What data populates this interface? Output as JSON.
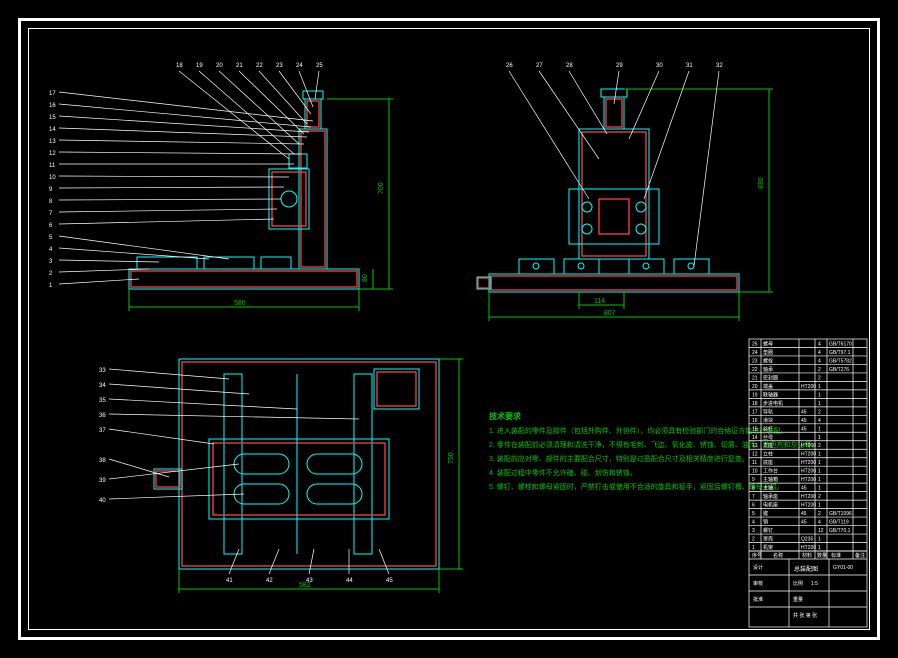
{
  "drawing": {
    "border_color": "#ffffff",
    "background": "#000000",
    "accent_cyan": "#00ffff",
    "accent_green": "#00c800",
    "accent_red": "#ff4040"
  },
  "views": {
    "front": {
      "dims": {
        "width": "580",
        "height": "700",
        "base_h": "80"
      }
    },
    "side": {
      "dims": {
        "width": "807",
        "height": "830",
        "slot": "114"
      }
    },
    "top": {
      "dims": {
        "width": "582",
        "height": "750"
      }
    }
  },
  "callouts": {
    "front_left": [
      "1",
      "2",
      "3",
      "4",
      "5",
      "6",
      "7",
      "8",
      "9",
      "10",
      "11",
      "12",
      "13",
      "14",
      "15",
      "16",
      "17"
    ],
    "front_top": [
      "18",
      "19",
      "20",
      "21",
      "22",
      "23",
      "24",
      "25"
    ],
    "side_top": [
      "26",
      "27",
      "28",
      "29",
      "30",
      "31",
      "32"
    ],
    "top_left": [
      "33",
      "34",
      "35",
      "36",
      "37",
      "38",
      "39",
      "40"
    ],
    "top_bottom": [
      "41",
      "42",
      "43",
      "44",
      "45"
    ]
  },
  "notes": {
    "title": "技术要求",
    "lines": [
      "1. 进入装配的零件及部件（包括外购件、外协件），均必须具有检验部门的合格证方能进行装配。",
      "2. 零件在装配前必须清理和清洗干净，不得有毛刺、飞边、氧化皮、锈蚀、切屑、油污、着色剂和灰尘等。",
      "3. 装配前应对零、部件的主要配合尺寸，特别是过盈配合尺寸及相关精度进行复查。",
      "4. 装配过程中零件不允许磕、碰、划伤和锈蚀。",
      "5. 螺钉、螺栓和螺母紧固时，严禁打击或使用不合适的旋具和扳手，紧固后螺钉槽、螺母无损。"
    ]
  },
  "title_block": {
    "rows": [
      {
        "no": "25",
        "name": "螺母",
        "mat": "",
        "qty": "4",
        "spec": "GB/T6170",
        "remark": ""
      },
      {
        "no": "24",
        "name": "垫圈",
        "mat": "",
        "qty": "4",
        "spec": "GB/T97.1",
        "remark": ""
      },
      {
        "no": "23",
        "name": "螺栓",
        "mat": "",
        "qty": "4",
        "spec": "GB/T5782",
        "remark": ""
      },
      {
        "no": "22",
        "name": "轴承",
        "mat": "",
        "qty": "2",
        "spec": "GB/T276",
        "remark": ""
      },
      {
        "no": "21",
        "name": "密封圈",
        "mat": "",
        "qty": "2",
        "spec": "",
        "remark": ""
      },
      {
        "no": "20",
        "name": "端盖",
        "mat": "HT200",
        "qty": "1",
        "spec": "",
        "remark": ""
      },
      {
        "no": "19",
        "name": "联轴器",
        "mat": "",
        "qty": "1",
        "spec": "",
        "remark": ""
      },
      {
        "no": "18",
        "name": "步进电机",
        "mat": "",
        "qty": "1",
        "spec": "",
        "remark": ""
      },
      {
        "no": "17",
        "name": "导轨",
        "mat": "45",
        "qty": "2",
        "spec": "",
        "remark": ""
      },
      {
        "no": "16",
        "name": "滑块",
        "mat": "45",
        "qty": "4",
        "spec": "",
        "remark": ""
      },
      {
        "no": "15",
        "name": "丝杠",
        "mat": "45",
        "qty": "1",
        "spec": "",
        "remark": ""
      },
      {
        "no": "14",
        "name": "丝母",
        "mat": "",
        "qty": "1",
        "spec": "",
        "remark": ""
      },
      {
        "no": "13",
        "name": "支座",
        "mat": "HT200",
        "qty": "2",
        "spec": "",
        "remark": ""
      },
      {
        "no": "12",
        "name": "立柱",
        "mat": "HT200",
        "qty": "1",
        "spec": "",
        "remark": ""
      },
      {
        "no": "11",
        "name": "底座",
        "mat": "HT200",
        "qty": "1",
        "spec": "",
        "remark": ""
      },
      {
        "no": "10",
        "name": "工作台",
        "mat": "HT200",
        "qty": "1",
        "spec": "",
        "remark": ""
      },
      {
        "no": "9",
        "name": "主轴箱",
        "mat": "HT200",
        "qty": "1",
        "spec": "",
        "remark": ""
      },
      {
        "no": "8",
        "name": "主轴",
        "mat": "45",
        "qty": "1",
        "spec": "",
        "remark": ""
      },
      {
        "no": "7",
        "name": "轴承座",
        "mat": "HT200",
        "qty": "2",
        "spec": "",
        "remark": ""
      },
      {
        "no": "6",
        "name": "电机座",
        "mat": "HT200",
        "qty": "1",
        "spec": "",
        "remark": ""
      },
      {
        "no": "5",
        "name": "键",
        "mat": "45",
        "qty": "2",
        "spec": "GB/T1096",
        "remark": ""
      },
      {
        "no": "4",
        "name": "销",
        "mat": "45",
        "qty": "4",
        "spec": "GB/T119",
        "remark": ""
      },
      {
        "no": "3",
        "name": "螺钉",
        "mat": "",
        "qty": "12",
        "spec": "GB/T70.1",
        "remark": ""
      },
      {
        "no": "2",
        "name": "罩壳",
        "mat": "Q235",
        "qty": "1",
        "spec": "",
        "remark": ""
      },
      {
        "no": "1",
        "name": "机架",
        "mat": "HT200",
        "qty": "1",
        "spec": "",
        "remark": ""
      }
    ],
    "header": {
      "no": "序号",
      "name": "名称",
      "mat": "材料",
      "qty": "数量",
      "spec": "标准",
      "remark": "备注"
    },
    "main": {
      "dwg_no": "GY01-00",
      "title": "总装配图",
      "scale_lbl": "比例",
      "scale": "1:5",
      "sheet_lbl": "共 张 第 张",
      "design": "设计",
      "check": "审核",
      "appr": "批准",
      "weight_lbl": "重量",
      "weight": ""
    }
  }
}
